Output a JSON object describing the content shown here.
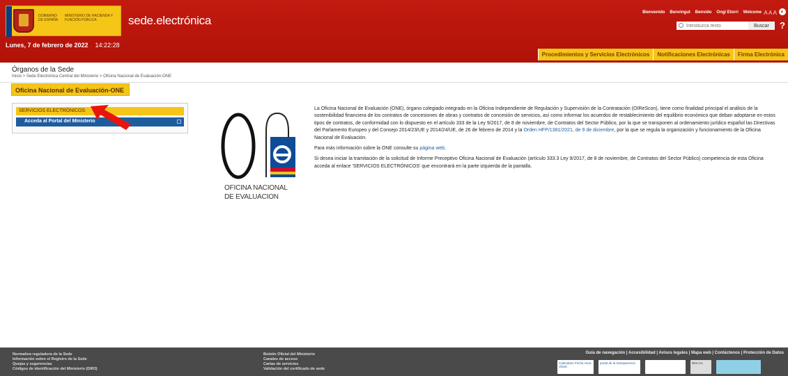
{
  "header": {
    "gobierno": "GOBIERNO DE ESPAÑA",
    "ministerio": "MINISTERIO DE HACIENDA Y FUNCIÓN PÚBLICA",
    "brand": "sede.electrónica",
    "date": "Lunes, 7 de febrero de 2022",
    "time": "14:22:28",
    "languages": [
      "Bienvenido",
      "Benvingut",
      "Benvido",
      "Ongi Etorri",
      "Welcome"
    ],
    "font_controls": "A A A",
    "search_placeholder": "Introduzca texto",
    "search_button": "Buscar",
    "help": "?",
    "nav_tabs": [
      "Procedimientos y Servicios Electrónicos",
      "Notificaciones Electrónicas",
      "Firma Electrónica"
    ]
  },
  "breadcrumb": {
    "section": "Órganos de la Sede",
    "path": "Inicio > Sede Electrónica Central del Ministerio > Oficina Nacional de Evaluación-ONE"
  },
  "left": {
    "title": "Oficina Nacional de Evaluación-ONE",
    "services": "SERVICIOS ELECTRÓNICOS",
    "portal": "Acceda al Portal del Ministerio"
  },
  "logo": {
    "line1": "OFICINA NACIONAL",
    "line2": "DE EVALUACION"
  },
  "content": {
    "p1_a": "La Oficina Nacional de Evaluación (ONE), órgano colegiado integrado en la Oficina Independiente de Regulación y Supervisión de la Contratación (OIReScon), tiene como finalidad principal el análisis de la sostenibilidad financiera de los contratos de concesiones de obras y contratos de concesión de servicios, así como informar los acuerdos de restablecimiento del equilibrio económico que deban adoptarse en estos tipos de contratos, de conformidad con lo dispuesto en el artículo 333 de la Ley 9/2017, de 8 de noviembre, de Contratos del Sector Público, por la que se transponen al ordenamiento jurídico español las Directivas del Parlamento Europeo y del Consejo 2014/23/UE y 2014/24/UE, de 26 de febrero de 2014 y la ",
    "p1_link": "Orden HFP/1381/2021, de 9 de diciembre",
    "p1_b": ", por la que se regula la organización y funcionamiento de la Oficina Nacional de Evaluación.",
    "p2_a": "Para más información sobre la ONE consulte su ",
    "p2_link": "página web",
    "p2_b": ".",
    "p3": "Si desea iniciar la tramitación de la solicitud de Informe Preceptivo Oficina Nacional de Evaluación (artículo 333.3 Ley 9/2017, de 8 de noviembre, de Contratos del Sector Público) competencia de esta Oficina acceda al enlace 'SERVICIOS ELECTRÓNICOS' que encontrará en la parte izquierda de la pantalla."
  },
  "footer": {
    "col1": [
      "Normativa reguladora de la Sede",
      "Información sobre el Registro de la Sede",
      "Quejas y sugerencias",
      "Códigos de identificación del Ministerio (DIR3)"
    ],
    "col2": [
      "Boletín Oficial del Ministerio",
      "Canales de acceso",
      "Cartas de servicios",
      "Validación del certificado de sede"
    ],
    "links": "Guía de navegación | Accesibilidad | Avisos legales | Mapa web | Contáctenos | Protección de Datos",
    "badges": [
      "Calendario Fecha Hora oficial",
      "portal de la transparencia",
      "",
      "WAI-AA",
      ""
    ]
  },
  "colors": {
    "header_red": "#b01208",
    "accent_yellow": "#f5c518",
    "link_blue": "#1f5c9e"
  }
}
